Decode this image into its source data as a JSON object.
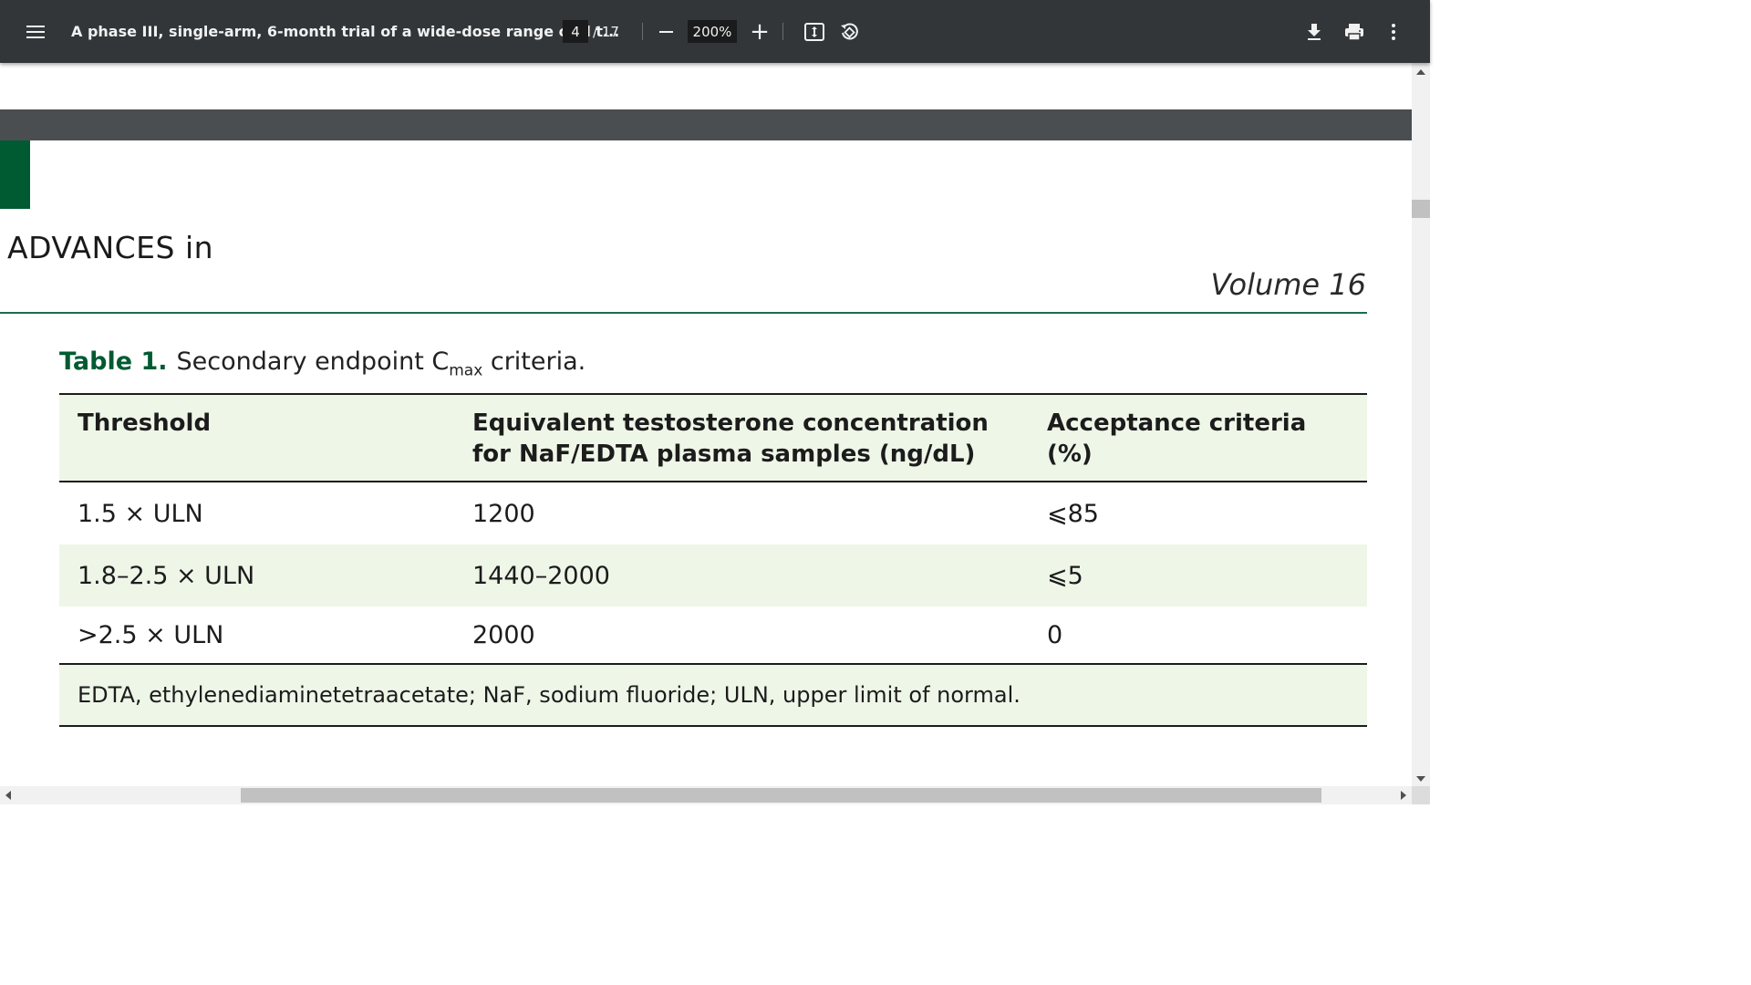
{
  "toolbar": {
    "title": "A phase III, single-arm, 6-month trial of a wide-dose range oral t...",
    "page_current": "4",
    "page_total": "/ 17",
    "zoom": "200%",
    "icons": {
      "menu": "menu-icon",
      "zoom_out": "minus-icon",
      "zoom_in": "plus-icon",
      "fit": "fit-to-page-icon",
      "rotate": "rotate-icon",
      "download": "download-icon",
      "print": "print-icon",
      "more": "more-vert-icon"
    }
  },
  "document": {
    "journal_name": "ADVANCES in",
    "volume": "Volume 16",
    "colors": {
      "brand_green": "#005a32",
      "table_tint": "#eef6e8",
      "band_grey": "#4b4e51"
    },
    "table": {
      "caption_label": "Table 1.",
      "caption_text": "Secondary endpoint C",
      "caption_sub": "max",
      "caption_tail": " criteria.",
      "headers": [
        "Threshold",
        "Equivalent testosterone concentration for NaF/EDTA plasma samples (ng/dL)",
        "Acceptance criteria (%)"
      ],
      "rows": [
        [
          "1.5 × ULN",
          "1200",
          "⩽85"
        ],
        [
          "1.8–2.5 × ULN",
          "1440–2000",
          "⩽5"
        ],
        [
          ">2.5 × ULN",
          "2000",
          "0"
        ]
      ],
      "footnote": "EDTA, ethylenediaminetetraacetate; NaF, sodium fluoride; ULN, upper limit of normal."
    }
  }
}
